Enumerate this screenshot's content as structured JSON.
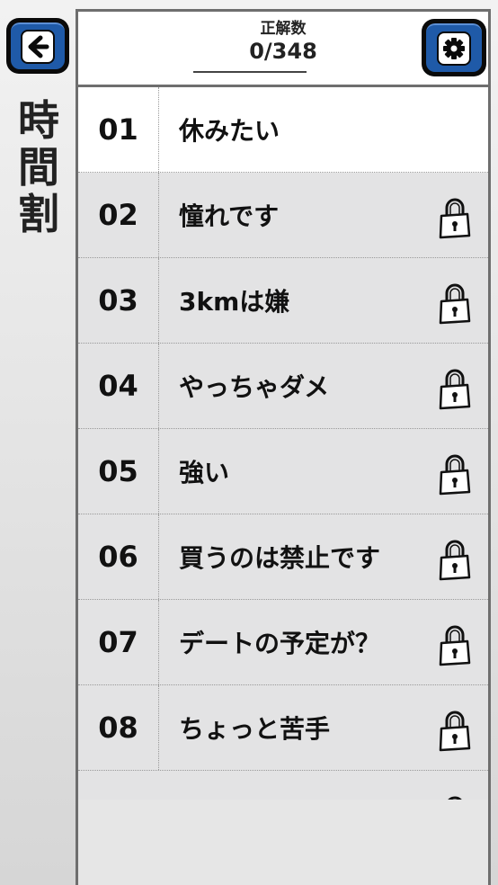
{
  "sidebar": {
    "title_chars": [
      "時",
      "間",
      "割"
    ]
  },
  "header": {
    "score_label": "正解数",
    "score_value": "0/348"
  },
  "colors": {
    "button_blue": "#1f5aa8",
    "row_locked": "#e3e3e4",
    "row_unlocked": "#ffffff"
  },
  "icons": {
    "back": "arrow-left-icon",
    "settings": "gear-icon",
    "lock": "padlock-icon"
  },
  "items": [
    {
      "num": "01",
      "title": "休みたい",
      "locked": false
    },
    {
      "num": "02",
      "title": "憧れです",
      "locked": true
    },
    {
      "num": "03",
      "title": "3kmは嫌",
      "locked": true
    },
    {
      "num": "04",
      "title": "やっちゃダメ",
      "locked": true
    },
    {
      "num": "05",
      "title": "強い",
      "locked": true
    },
    {
      "num": "06",
      "title": "買うのは禁止です",
      "locked": true
    },
    {
      "num": "07",
      "title": "デートの予定が？",
      "locked": true
    },
    {
      "num": "08",
      "title": "ちょっと苦手",
      "locked": true
    }
  ]
}
